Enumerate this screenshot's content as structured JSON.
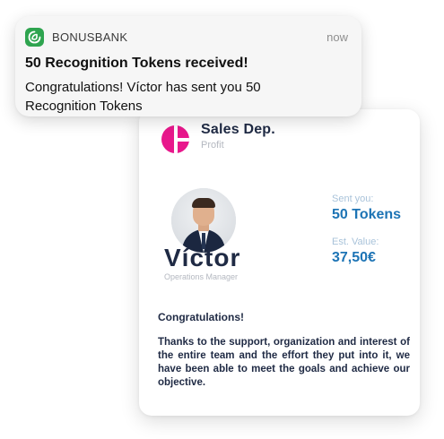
{
  "notification": {
    "app_icon": "bonusbank-logo-icon",
    "app_name": "BONUSBANK",
    "time": "now",
    "title": "50 Recognition Tokens received!",
    "body": "Congratulations! Víctor has sent you 50 Recognition Tokens"
  },
  "card": {
    "department": {
      "logo_icon": "department-logo-icon",
      "logo_color": "#e8188c",
      "name": "Sales Dep.",
      "subtitle": "Profit"
    },
    "sender": {
      "avatar": "person-avatar",
      "name": "Víctor",
      "role": "Operations Manager"
    },
    "stats": {
      "sent_label": "Sent you:",
      "sent_value": "50 Tokens",
      "value_label": "Est. Value:",
      "value_amount": "37,50€"
    },
    "message": {
      "title": "Congratulations!",
      "body": "Thanks to the support, organization and interest of the entire team and the effort they put into it, we have been able to meet the goals and achieve our objective."
    }
  },
  "colors": {
    "brand_green": "#2ea44f",
    "accent_blue": "#1d74b5",
    "text_navy": "#1f2a44"
  }
}
